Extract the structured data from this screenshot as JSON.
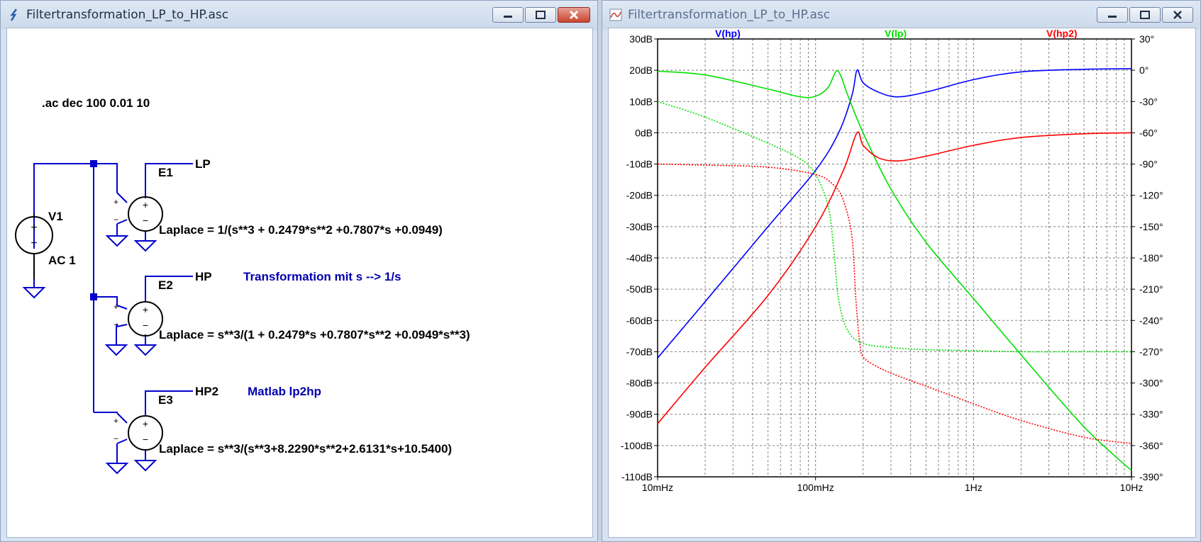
{
  "left_window": {
    "title": "Filtertransformation_LP_to_HP.asc",
    "directive": ".ac dec 100 0.01 10",
    "source": {
      "name": "V1",
      "value": "AC 1"
    },
    "sources": [
      {
        "name": "E1",
        "net": "LP",
        "laplace": "Laplace = 1/(s**3 + 0.2479*s**2 +0.7807*s +0.0949)",
        "comment": ""
      },
      {
        "name": "E2",
        "net": "HP",
        "laplace": "Laplace = s**3/(1 + 0.2479*s +0.7807*s**2 +0.0949*s**3)",
        "comment": "Transformation mit s --> 1/s"
      },
      {
        "name": "E3",
        "net": "HP2",
        "laplace": "Laplace = s**3/(s**3+8.2290*s**2+2.6131*s+10.5400)",
        "comment": "Matlab lp2hp"
      }
    ],
    "wire_color": "#0000cc",
    "comment_color": "#0000b0"
  },
  "right_window": {
    "title": "Filtertransformation_LP_to_HP.asc",
    "title_color": "#5a6f8d"
  },
  "chart_data": {
    "type": "line",
    "x_scale": "log",
    "xlim": [
      0.01,
      10
    ],
    "x_ticks": [
      0.01,
      0.1,
      1,
      10
    ],
    "x_tick_labels": [
      "10mHz",
      "100mHz",
      "1Hz",
      "10Hz"
    ],
    "ylim": [
      -110,
      30
    ],
    "y_ticks": [
      30,
      20,
      10,
      0,
      -10,
      -20,
      -30,
      -40,
      -50,
      -60,
      -70,
      -80,
      -90,
      -100,
      -110
    ],
    "y_tick_labels": [
      "30dB",
      "20dB",
      "10dB",
      "0dB",
      "-10dB",
      "-20dB",
      "-30dB",
      "-40dB",
      "-50dB",
      "-60dB",
      "-70dB",
      "-80dB",
      "-90dB",
      "-100dB",
      "-110dB"
    ],
    "y2lim": [
      -390,
      30
    ],
    "y2_ticks": [
      30,
      0,
      -30,
      -60,
      -90,
      -120,
      -150,
      -180,
      -210,
      -240,
      -270,
      -300,
      -330,
      -360,
      -390
    ],
    "y2_tick_labels": [
      "30°",
      "0°",
      "-30°",
      "-60°",
      "-90°",
      "-120°",
      "-150°",
      "-180°",
      "-210°",
      "-240°",
      "-270°",
      "-300°",
      "-330°",
      "-360°",
      "-390°"
    ],
    "grid": true,
    "legend": "top",
    "series": [
      {
        "name": "V(hp)",
        "color": "#0000ff",
        "magnitude": {
          "x": [
            0.01,
            0.02,
            0.05,
            0.1,
            0.14,
            0.17,
            0.183,
            0.2,
            0.25,
            0.33,
            0.5,
            1,
            2,
            5,
            10
          ],
          "y": [
            -72,
            -54,
            -30,
            -12,
            0,
            12,
            20,
            16,
            13,
            11.5,
            13,
            17,
            19.5,
            20.3,
            20.5
          ]
        },
        "phase": null
      },
      {
        "name": "V(lp)",
        "color": "#00e000",
        "magnitude": {
          "x": [
            0.01,
            0.02,
            0.05,
            0.08,
            0.1,
            0.12,
            0.135,
            0.145,
            0.16,
            0.2,
            0.3,
            0.5,
            1,
            2,
            5,
            10
          ],
          "y": [
            19.7,
            18.5,
            14,
            11.5,
            11.7,
            14.5,
            19.7,
            18,
            12,
            0,
            -18,
            -35,
            -53,
            -71,
            -94,
            -108
          ]
        },
        "phase": {
          "x": [
            0.01,
            0.02,
            0.05,
            0.08,
            0.1,
            0.12,
            0.13,
            0.14,
            0.16,
            0.2,
            0.3,
            0.5,
            1,
            2,
            5,
            10
          ],
          "y": [
            -30,
            -45,
            -70,
            -85,
            -100,
            -130,
            -170,
            -220,
            -250,
            -262,
            -266,
            -268,
            -269,
            -270,
            -270,
            -270
          ]
        }
      },
      {
        "name": "V(hp2)",
        "color": "#ff0000",
        "magnitude": {
          "x": [
            0.01,
            0.02,
            0.05,
            0.1,
            0.15,
            0.183,
            0.2,
            0.25,
            0.33,
            0.5,
            1,
            2,
            5,
            10
          ],
          "y": [
            -93,
            -75,
            -52,
            -30,
            -12,
            0,
            -4,
            -8,
            -9,
            -7.5,
            -4,
            -1.5,
            -0.3,
            0
          ]
        },
        "phase": {
          "x": [
            0.01,
            0.02,
            0.05,
            0.1,
            0.13,
            0.15,
            0.17,
            0.18,
            0.19,
            0.2,
            0.25,
            0.33,
            0.5,
            1,
            2,
            5,
            10
          ],
          "y": [
            -90,
            -91,
            -93,
            -100,
            -110,
            -125,
            -160,
            -220,
            -260,
            -275,
            -285,
            -293,
            -303,
            -320,
            -336,
            -352,
            -358
          ]
        }
      }
    ]
  }
}
